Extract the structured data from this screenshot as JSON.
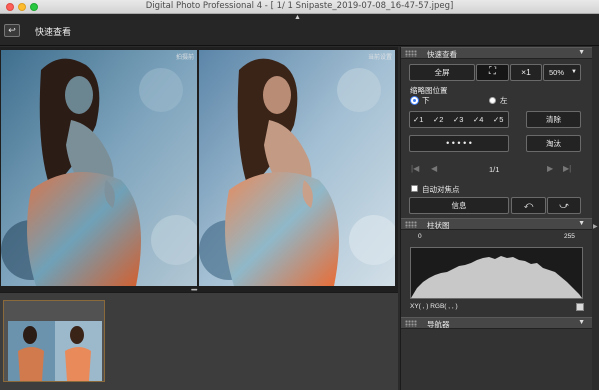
{
  "window": {
    "title": "Digital Photo Professional 4 - [    1/    1 Snipaste_2019-07-08_16-47-57.jpeg]"
  },
  "toolbar": {
    "back_icon": "back-arrow-icon",
    "title": "快速查看"
  },
  "viewer": {
    "left_tag": "拍摄前",
    "right_tag": "当前设置"
  },
  "quick_view_panel": {
    "title": "快速查看",
    "fullscreen_label": "全屏",
    "fit_icon": "fit-screen-icon",
    "zoom_1x_label": "×1",
    "zoom_value": "50%",
    "thumb_position_label": "缩略图位置",
    "position_bottom_label": "下",
    "position_left_label": "左",
    "position_selected": "下",
    "check_marks": [
      "✓1",
      "✓2",
      "✓3",
      "✓4",
      "✓5"
    ],
    "clear_label": "清除",
    "dots_label": "•   •   •   •   •",
    "reject_label": "淘汰",
    "page_indicator": "1/1",
    "autofocus_label": "自动对焦点",
    "info_label": "信息"
  },
  "histogram_panel": {
    "title": "柱状图",
    "axis_min": "0",
    "axis_max": "255",
    "readout": "XY(      ,      )  RGB(      ,      ,      )"
  },
  "navigator_panel": {
    "title": "导航器"
  },
  "colors": {
    "panel_bg": "#333333",
    "header_bg": "#474747",
    "accent_radio": "#3d7cf5",
    "thumb_border": "#8a6a3a"
  }
}
